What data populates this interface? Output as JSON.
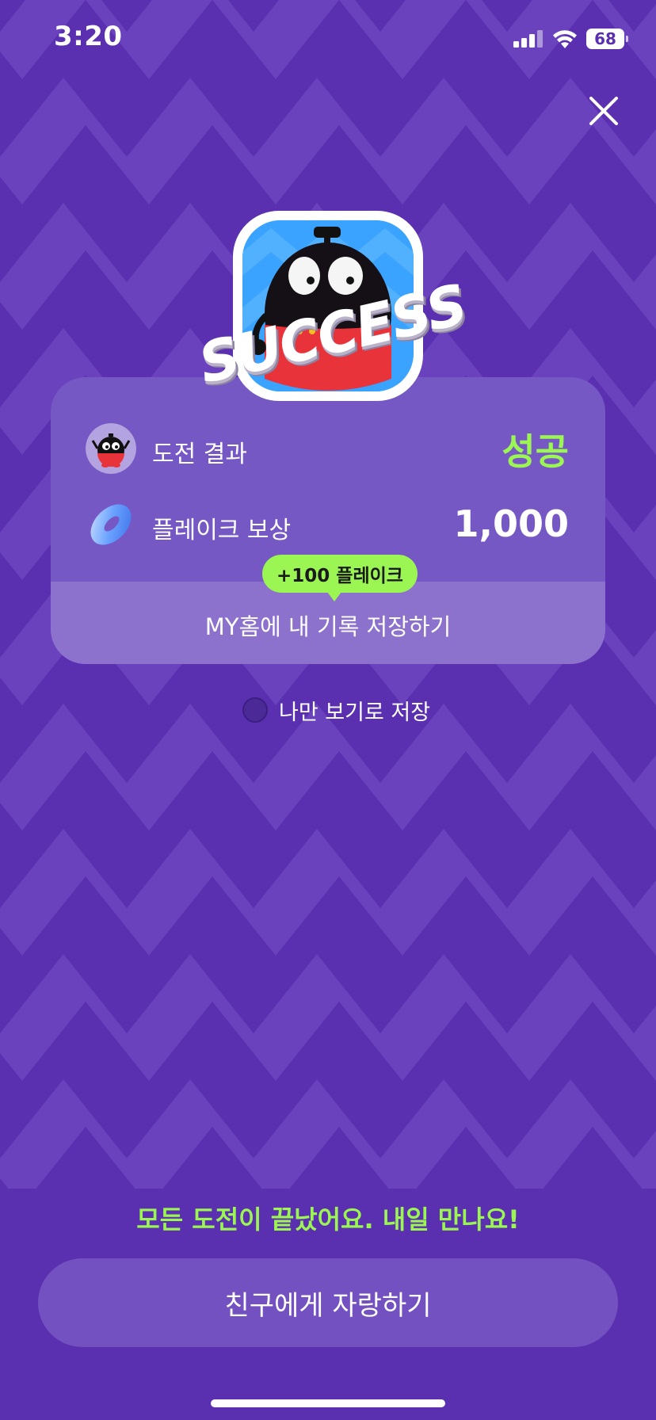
{
  "status_bar": {
    "time": "3:20",
    "battery": "68",
    "icons": [
      "signal-icon",
      "wifi-icon",
      "battery-icon"
    ]
  },
  "header": {
    "close_icon": "close-icon"
  },
  "badge": {
    "text": "SUCCESS",
    "character": "black-round-character"
  },
  "result_card": {
    "challenge_result": {
      "label": "도전 결과",
      "value": "성공"
    },
    "reward": {
      "label": "플레이크 보상",
      "value": "1,000"
    },
    "tooltip": "+100 플레이크",
    "save_record": "MY홈에 내 기록 저장하기"
  },
  "private_option": {
    "label": "나만 보기로 저장",
    "checked": false
  },
  "footer": {
    "message": "모든 도전이 끝났어요. 내일 만나요!",
    "share_button": "친구에게 자랑하기"
  },
  "colors": {
    "background": "#5a2fb0",
    "accent_green": "#9bf553",
    "card": "#7658c4",
    "button": "#7451c0"
  }
}
